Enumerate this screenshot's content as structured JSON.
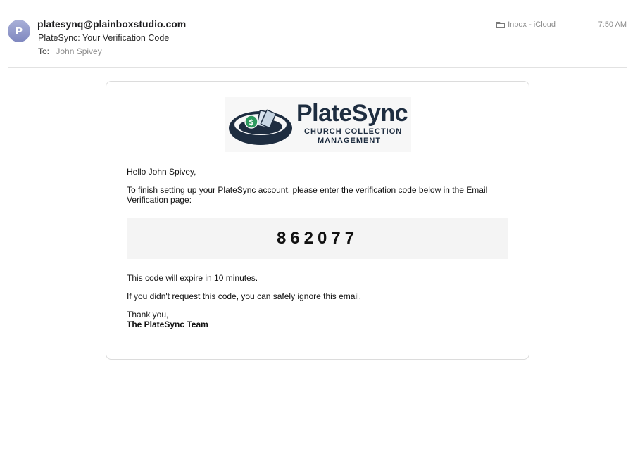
{
  "header": {
    "avatar_initial": "P",
    "from": "platesynq@plainboxstudio.com",
    "subject": "PlateSync: Your Verification Code",
    "to_label": "To:",
    "to_name": "John Spivey",
    "mailbox": "Inbox - iCloud",
    "time": "7:50 AM"
  },
  "logo": {
    "name": "PlateSync",
    "tagline_line1": "CHURCH COLLECTION",
    "tagline_line2": "MANAGEMENT",
    "icon": "collection-plate-icon"
  },
  "body": {
    "greeting": "Hello John Spivey,",
    "instructions": "To finish setting up your PlateSync account, please enter the verification code below in the Email Verification page:",
    "code": "862077",
    "expire": "This code will expire in 10 minutes.",
    "ignore": "If you didn't request this code, you can safely ignore this email.",
    "thanks": "Thank you,",
    "team": "The PlateSync Team"
  },
  "colors": {
    "brand_navy": "#1e2d40",
    "brand_green": "#2e9a5e",
    "avatar": "#8f96c8"
  }
}
